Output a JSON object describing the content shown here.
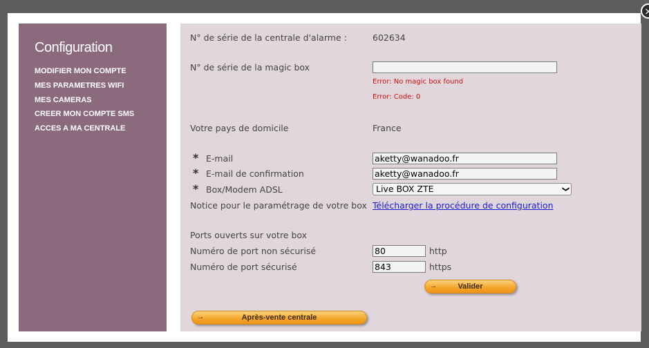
{
  "close": {
    "icon": "close-icon",
    "glyph": "×"
  },
  "sidebar": {
    "title": "Configuration",
    "items": [
      {
        "label": "MODIFIER MON COMPTE"
      },
      {
        "label": "MES PARAMETRES WIFI"
      },
      {
        "label": "MES CAMERAS"
      },
      {
        "label": "CREER MON COMPTE SMS"
      },
      {
        "label": "ACCES A MA CENTRALE"
      }
    ]
  },
  "form": {
    "alarm_serial_label": "N° de série de la centrale d'alarme :",
    "alarm_serial_value": "602634",
    "magicbox_label": "N° de série de la magic box",
    "magicbox_value": "",
    "error1": "Error: No magic box found",
    "error2": "Error: Code: 0",
    "country_label": "Votre pays de domicile",
    "country_value": "France",
    "required_mark": "*",
    "email_label": "E-mail",
    "email_value": "aketty@wanadoo.fr",
    "email_confirm_label": "E-mail de confirmation",
    "email_confirm_value": "aketty@wanadoo.fr",
    "box_label": "Box/Modem ADSL",
    "box_selected": "Live BOX ZTE",
    "box_arrow": "❯",
    "notice_label": "Notice pour le paramétrage de votre box",
    "notice_link": "Télécharger la procédure de configuration",
    "ports_heading": "Ports ouverts sur votre box",
    "port_insecure_label": "Numéro de port non sécurisé",
    "port_insecure_value": "80",
    "port_insecure_proto": "http",
    "port_secure_label": "Numéro de port sécurisé",
    "port_secure_value": "843",
    "port_secure_proto": "https",
    "validate_label": "Valider",
    "aftersales_label": "Après-vente centrale",
    "button_arrow": "→"
  },
  "colors": {
    "sidebar_bg": "#8a6a7c",
    "content_bg": "#e0d6dc",
    "error": "#cc1111",
    "link": "#1a1ad6",
    "button": "#f5a52a"
  }
}
